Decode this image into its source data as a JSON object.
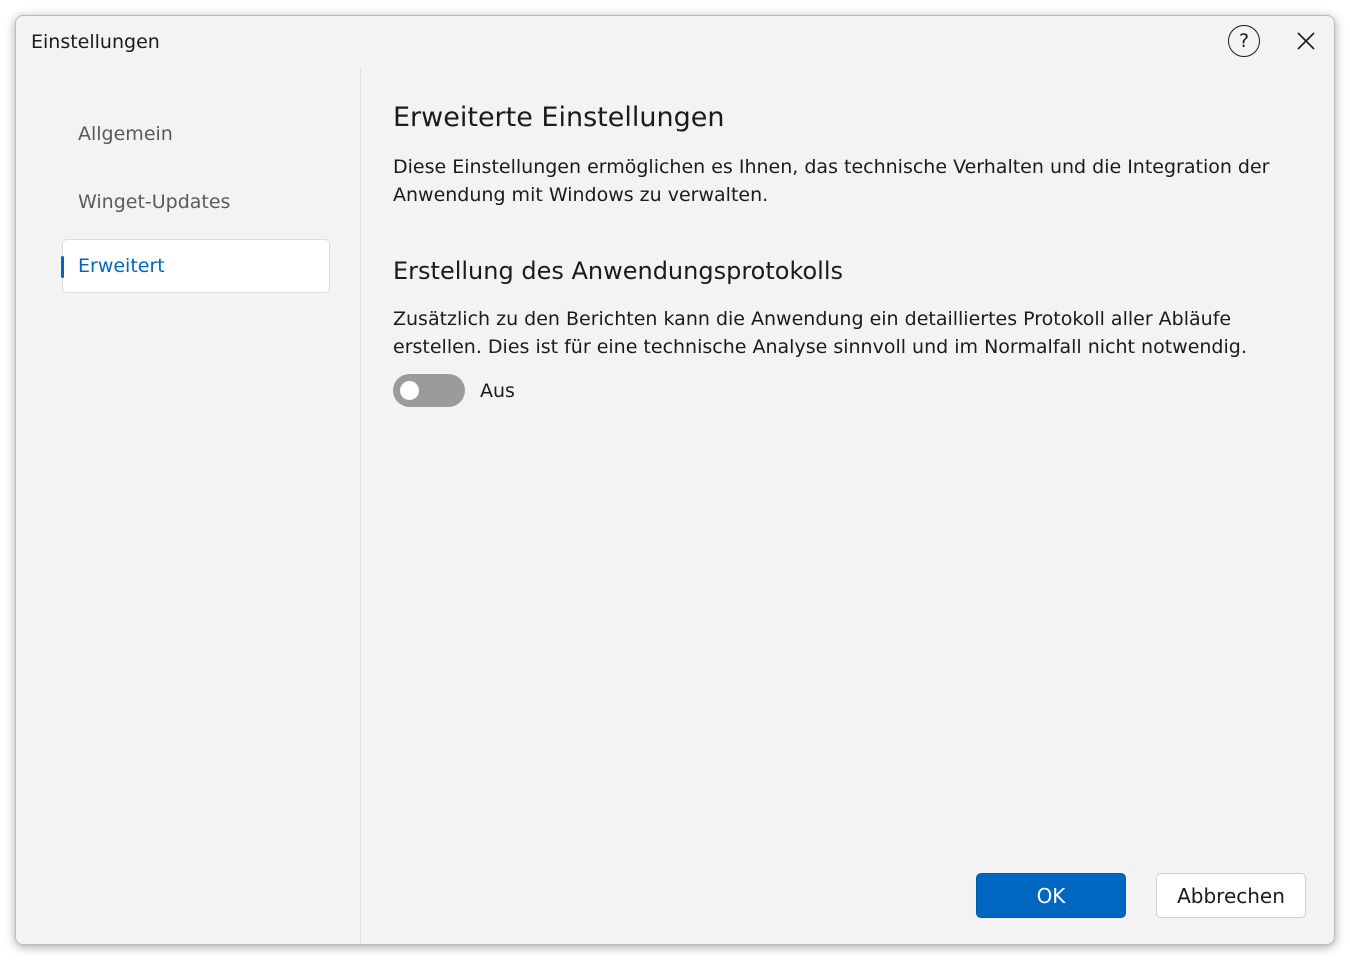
{
  "window": {
    "title": "Einstellungen",
    "help_glyph": "?",
    "help_icon": "help-circle-icon",
    "close_icon": "close-icon"
  },
  "sidebar": {
    "items": [
      {
        "label": "Allgemein",
        "active": false
      },
      {
        "label": "Winget-Updates",
        "active": false
      },
      {
        "label": "Erweitert",
        "active": true
      }
    ]
  },
  "content": {
    "heading": "Erweiterte Einstellungen",
    "description": "Diese Einstellungen ermöglichen es Ihnen, das technische Verhalten und die Integration der Anwendung mit Windows zu verwalten.",
    "section": {
      "heading": "Erstellung des Anwendungsprotokolls",
      "description": "Zusätzlich zu den Berichten kann die Anwendung ein detailliertes Protokoll aller Abläufe erstellen. Dies ist für eine technische Analyse sinnvoll und im Normalfall nicht notwendig.",
      "toggle": {
        "state": false,
        "label": "Aus"
      }
    }
  },
  "footer": {
    "ok_label": "OK",
    "cancel_label": "Abbrechen"
  },
  "colors": {
    "accent": "#0067c0",
    "background": "#f3f3f3",
    "toggle_off": "#9b9b9b"
  }
}
